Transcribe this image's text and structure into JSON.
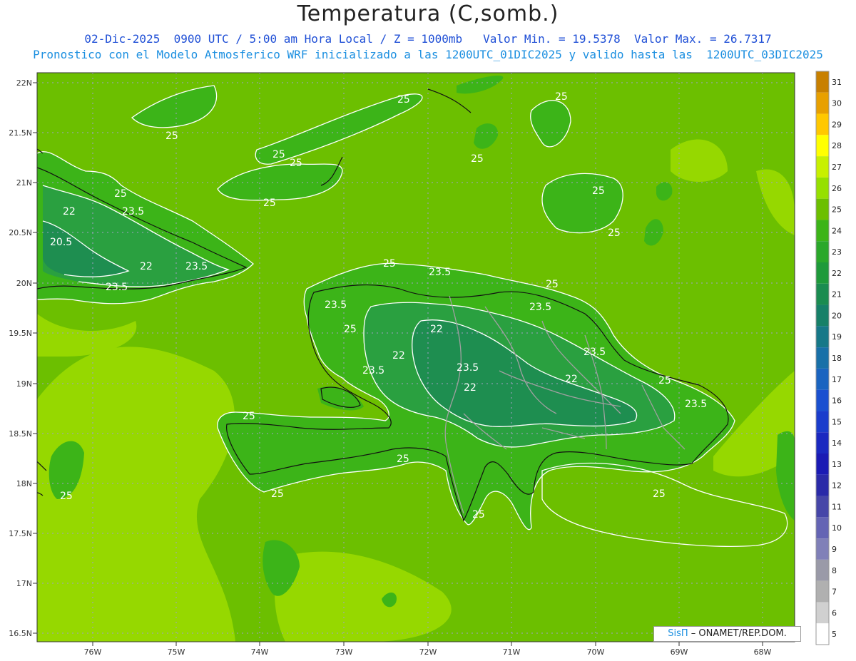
{
  "header": {
    "title": "Temperatura (C,somb.)",
    "line1": "02-Dic-2025  0900 UTC / 5:00 am Hora Local / Z = 1000mb   Valor Min. = 19.5378  Valor Max. = 26.7317",
    "line2": "Pronostico con el Modelo Atmosferico WRF inicializado a las 1200UTC_01DIC2025 y valido hasta las  1200UTC_03DIC2025"
  },
  "axes": {
    "lat_labels": [
      "22N",
      "21.5N",
      "21N",
      "20.5N",
      "20N",
      "19.5N",
      "19N",
      "18.5N",
      "18N",
      "17.5N",
      "17N",
      "16.5N"
    ],
    "lon_labels": [
      "76W",
      "75W",
      "74W",
      "73W",
      "72W",
      "71W",
      "70W",
      "69W",
      "68W"
    ]
  },
  "contour_labels": [
    "25",
    "25",
    "25",
    "25",
    "25",
    "25",
    "25",
    "25",
    "25",
    "25",
    "25",
    "25",
    "25",
    "25",
    "25",
    "25",
    "25",
    "25",
    "25",
    "25",
    "23.5",
    "23.5",
    "23.5",
    "23.5",
    "23.5",
    "23.5",
    "23.5",
    "23.5",
    "23.5",
    "23.5",
    "22",
    "22",
    "22",
    "22",
    "22",
    "22",
    "20.5"
  ],
  "legend": {
    "levels": [
      "31",
      "30",
      "29",
      "28",
      "27",
      "26",
      "25",
      "24",
      "23",
      "22",
      "21",
      "20",
      "19",
      "18",
      "17",
      "16",
      "15",
      "14",
      "13",
      "12",
      "11",
      "10",
      "9",
      "8",
      "7",
      "6",
      "5"
    ],
    "colors": [
      "#c88000",
      "#e8a000",
      "#ffc800",
      "#ffff00",
      "#c8f000",
      "#96e000",
      "#6cbf00",
      "#3cb418",
      "#2aa82a",
      "#1e9a3a",
      "#1a8c50",
      "#168068",
      "#167888",
      "#1870a8",
      "#1a64c0",
      "#1a50d0",
      "#1a3ccc",
      "#1a28c0",
      "#1a1ab4",
      "#2a2aa8",
      "#4646a8",
      "#6464b4",
      "#8080b8",
      "#9a9aa8",
      "#b0b0b0",
      "#d0d0d0",
      "#ffffff"
    ]
  },
  "colors": {
    "sea_main": "#6cbf00",
    "sea_warm": "#96d800",
    "land_main": "#3cb418",
    "land_cool": "#2aa040",
    "land_cold": "#1e8e50",
    "grid": "#a0a0c8"
  },
  "credit": {
    "brand": "SisΠ",
    "text": " – ONAMET/REP.DOM."
  }
}
